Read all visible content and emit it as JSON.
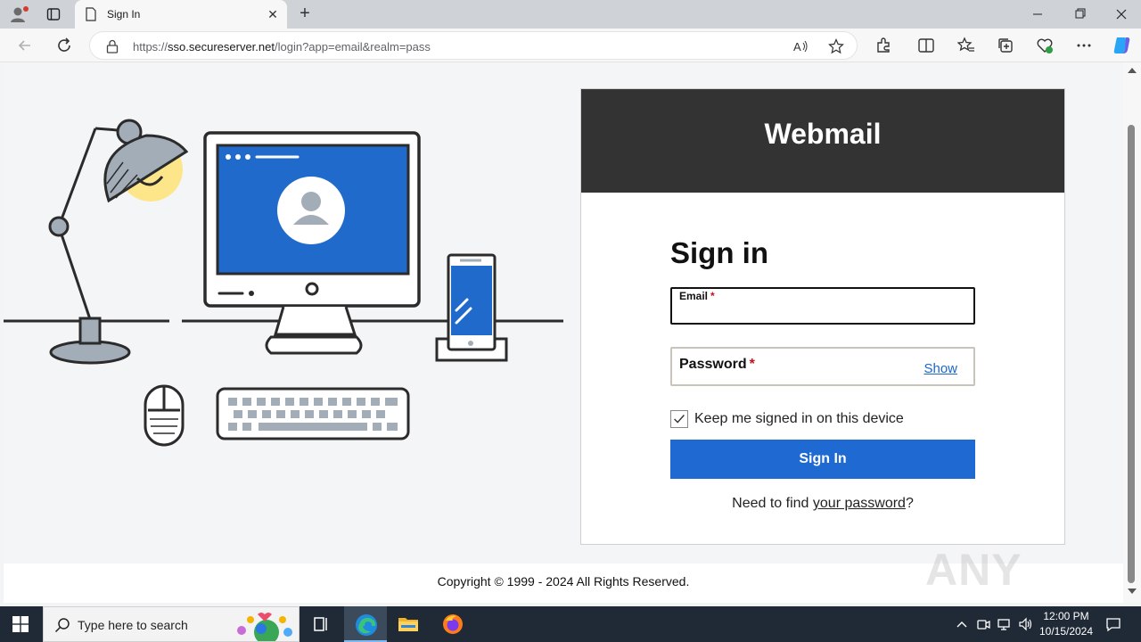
{
  "browser": {
    "tab_title": "Sign In",
    "url_scheme": "https://",
    "url_host": "sso.secureserver.net",
    "url_path": "/login?app=email&realm=pass"
  },
  "page": {
    "brand": "Webmail",
    "heading": "Sign in",
    "email_label": "Email",
    "password_label": "Password",
    "required_mark": "*",
    "show_label": "Show",
    "keep_signed_in_label": "Keep me signed in on this device",
    "keep_signed_in_checked": true,
    "signin_button": "Sign In",
    "find_prefix": "Need to find ",
    "find_link": "your password",
    "find_suffix": "?",
    "copyright": "Copyright © 1999 - 2024 All Rights Reserved.",
    "watermark": "ANY RUN"
  },
  "taskbar": {
    "search_placeholder": "Type here to search",
    "time": "12:00 PM",
    "date": "10/15/2024"
  },
  "colors": {
    "header_bg": "#333333",
    "primary_button": "#1e6ad2",
    "link": "#1b66c9",
    "illustration_blue": "#1f6acb",
    "lamp_light": "#fde68a"
  }
}
